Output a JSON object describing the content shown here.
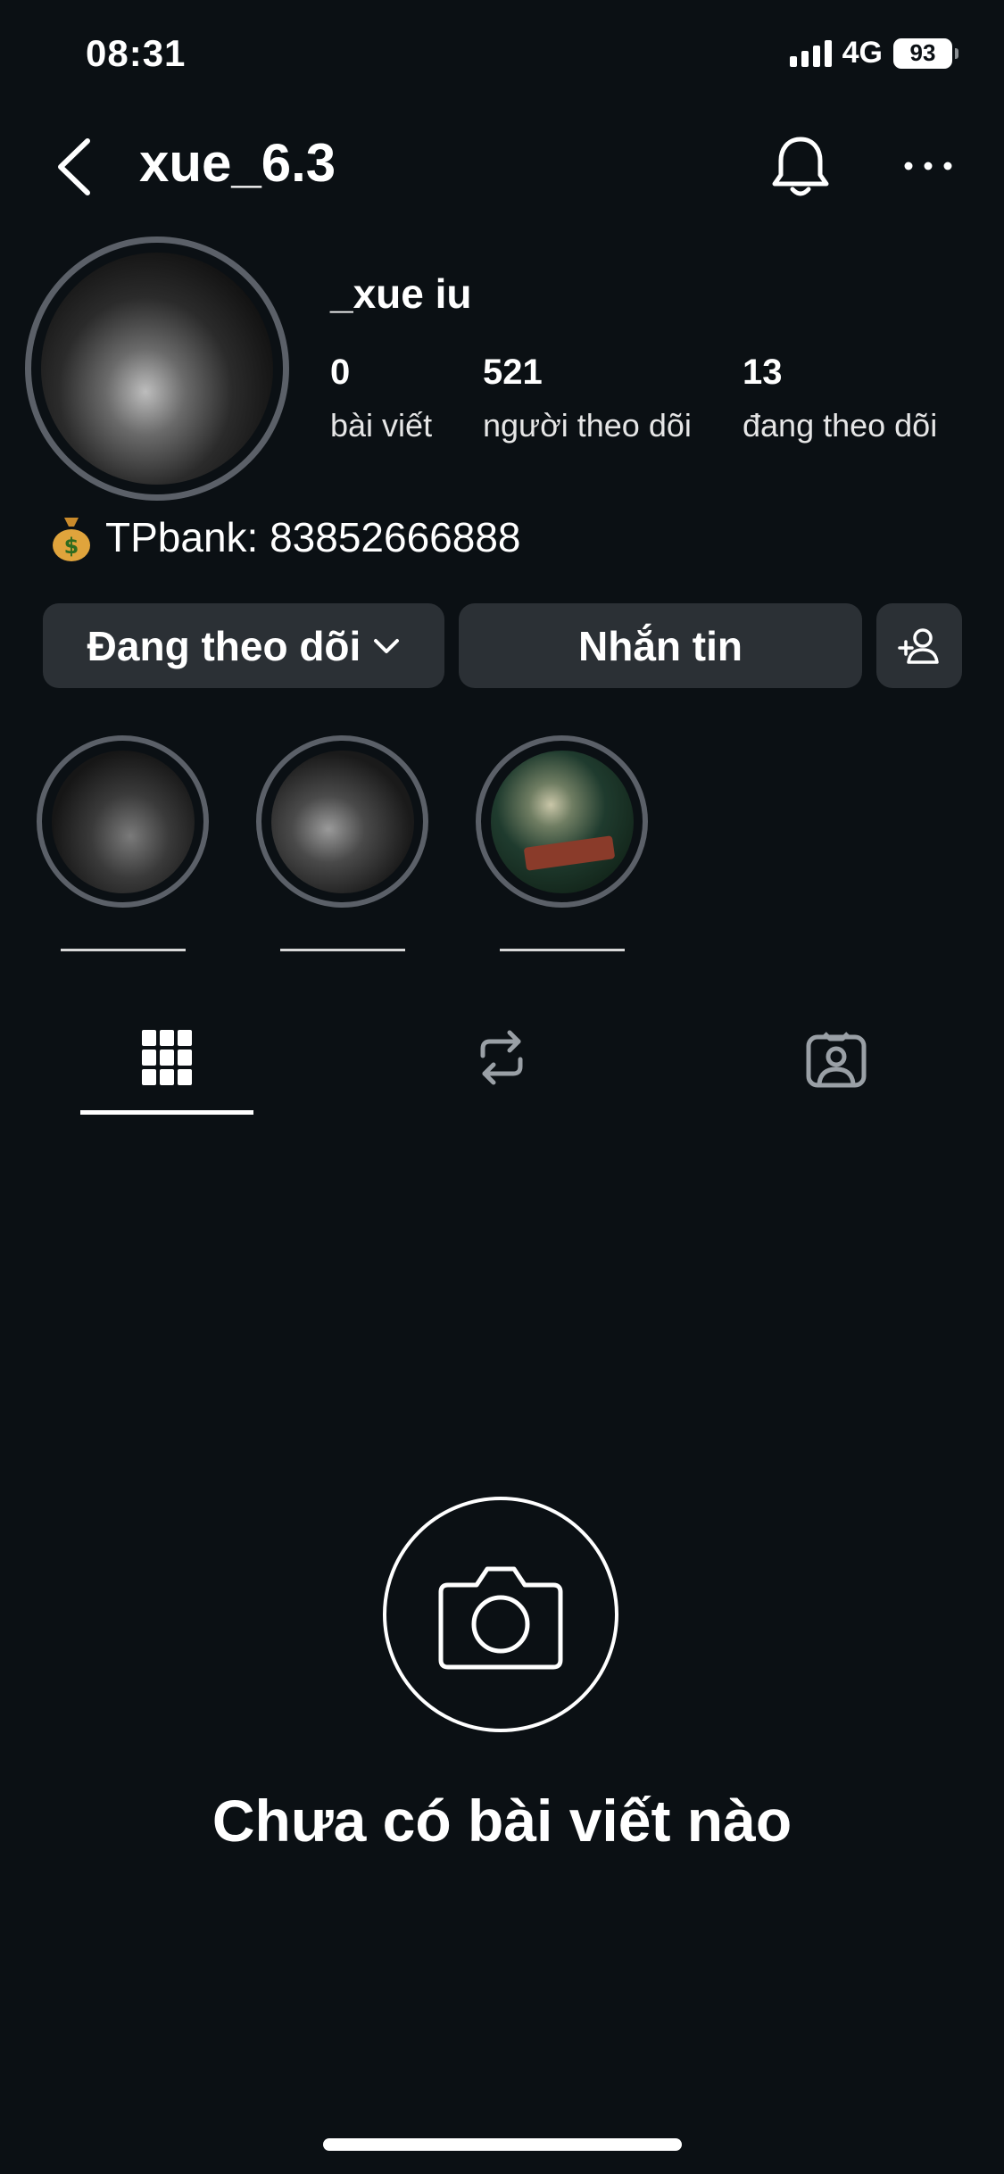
{
  "status_bar": {
    "time": "08:31",
    "network": "4G",
    "battery": "93"
  },
  "header": {
    "username": "xue_6.3"
  },
  "profile": {
    "display_name": "_xue iu",
    "stats": [
      {
        "value": "0",
        "label": "bài viết"
      },
      {
        "value": "521",
        "label": "người theo dõi"
      },
      {
        "value": "13",
        "label": "đang theo dõi"
      }
    ],
    "bio": "TPbank: 83852666888"
  },
  "actions": {
    "following_label": "Đang theo dõi",
    "message_label": "Nhắn tin"
  },
  "highlights": [
    {
      "label": ""
    },
    {
      "label": ""
    },
    {
      "label": ""
    }
  ],
  "tabs": [
    {
      "name": "grid",
      "icon": "grid-icon",
      "active": true
    },
    {
      "name": "reposts",
      "icon": "repost-icon",
      "active": false
    },
    {
      "name": "tagged",
      "icon": "tagged-icon",
      "active": false
    }
  ],
  "empty_state": {
    "title": "Chưa có bài viết nào",
    "icon": "camera-icon"
  },
  "colors": {
    "background": "#0b1014",
    "button": "#2b3035",
    "ring": "#5b6068"
  }
}
